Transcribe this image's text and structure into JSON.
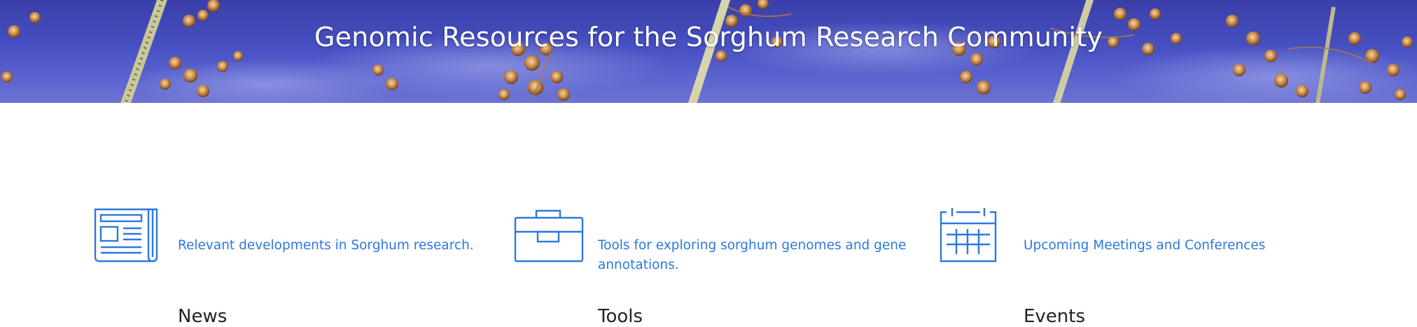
{
  "hero": {
    "title": "Genomic Resources for the Sorghum Research Community"
  },
  "features": [
    {
      "icon": "newspaper-icon",
      "title": "News",
      "description": "Relevant developments in Sorghum research."
    },
    {
      "icon": "toolbox-icon",
      "title": "Tools",
      "description": "Tools for exploring sorghum genomes and gene annotations."
    },
    {
      "icon": "calendar-icon",
      "title": "Events",
      "description": "Upcoming Meetings and Conferences"
    }
  ],
  "colors": {
    "accent": "#2b78e0",
    "title": "#222222",
    "hero_sky": "#4750c2"
  }
}
